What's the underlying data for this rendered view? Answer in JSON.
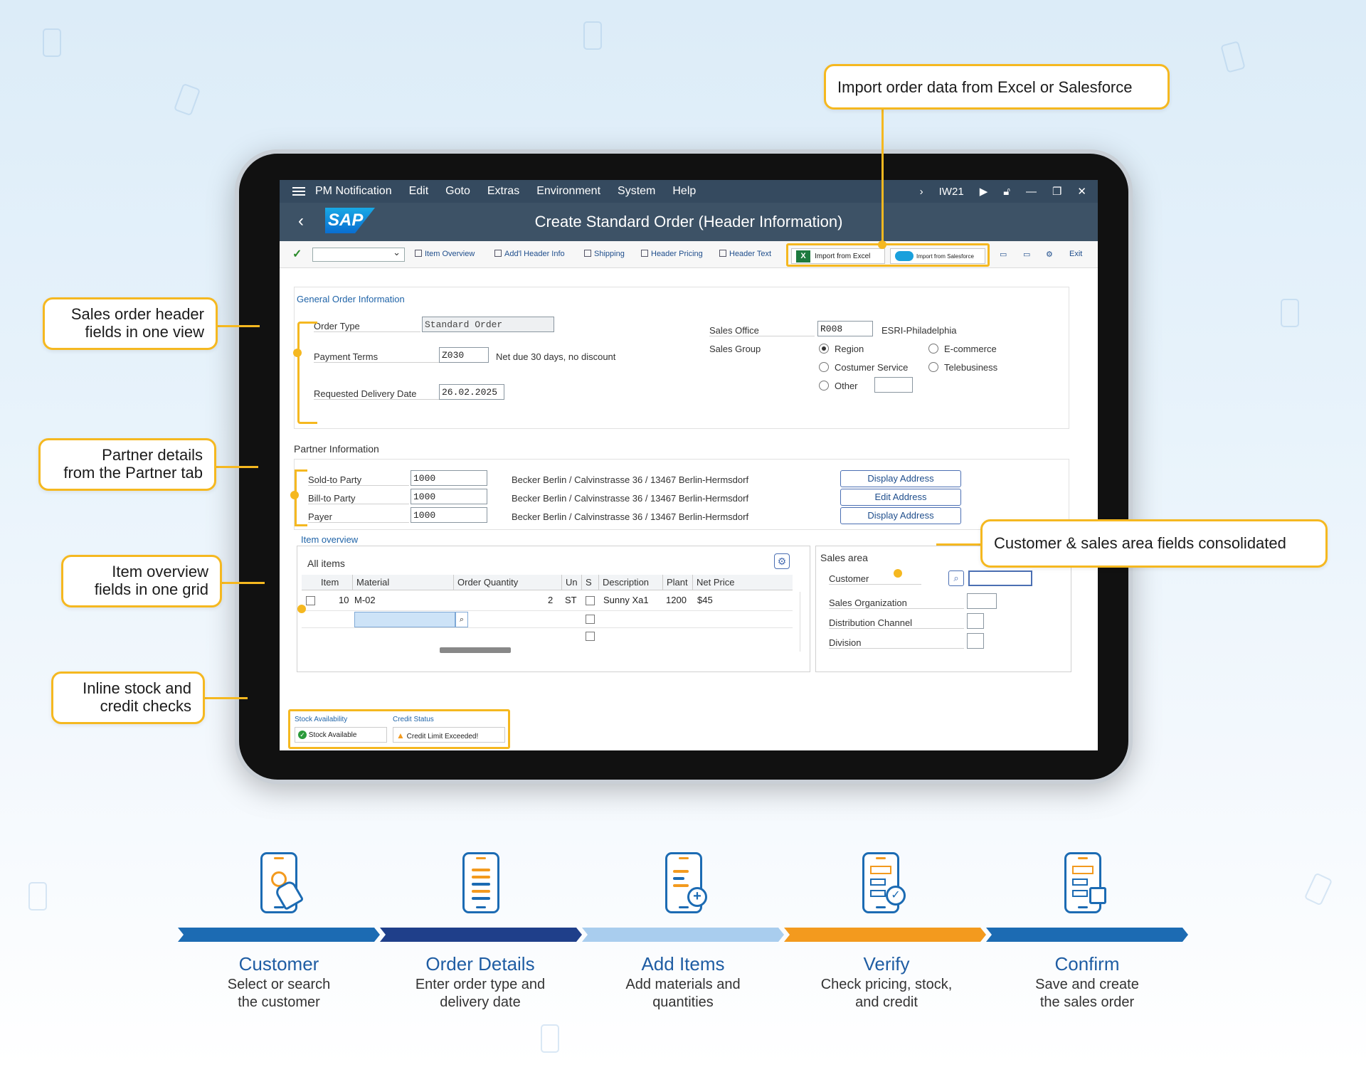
{
  "window": {
    "menu": [
      "PM Notification",
      "Edit",
      "Goto",
      "Extras",
      "Environment",
      "System",
      "Help"
    ],
    "tcode": "IW21",
    "title": "Create Standard Order (Header Information)",
    "logo": "SAP"
  },
  "toolbar": {
    "items": [
      "Item Overview",
      "Add'l Header Info",
      "Shipping",
      "Header Pricing",
      "Header Text"
    ],
    "import_excel": "Import from Excel",
    "import_salesforce": "Import from Salesforce",
    "exit": "Exit"
  },
  "general": {
    "heading": "General Order Information",
    "order_type_label": "Order Type",
    "order_type_value": "Standard Order",
    "payment_terms_label": "Payment Terms",
    "payment_terms_value": "Z030",
    "payment_terms_desc": "Net due 30 days, no discount",
    "delivery_date_label": "Requested Delivery Date",
    "delivery_date_value": "26.02.2025",
    "sales_office_label": "Sales Office",
    "sales_office_value": "R008",
    "sales_office_desc": "ESRI-Philadelphia",
    "sales_group_label": "Sales Group",
    "radios": [
      {
        "label": "Region",
        "checked": true
      },
      {
        "label": "E-commerce",
        "checked": false
      },
      {
        "label": "Costumer Service",
        "checked": false
      },
      {
        "label": "Telebusiness",
        "checked": false
      },
      {
        "label": "Other",
        "checked": false
      }
    ]
  },
  "partner": {
    "heading": "Partner Information",
    "rows": [
      {
        "label": "Sold-to Party",
        "value": "1000",
        "address": "Becker Berlin / Calvinstrasse 36 / 13467 Berlin-Hermsdorf",
        "button": "Display Address"
      },
      {
        "label": "Bill-to Party",
        "value": "1000",
        "address": "Becker Berlin / Calvinstrasse 36 / 13467 Berlin-Hermsdorf",
        "button": "Edit Address"
      },
      {
        "label": "Payer",
        "value": "1000",
        "address": "Becker Berlin / Calvinstrasse 36 / 13467 Berlin-Hermsdorf",
        "button": "Display Address"
      }
    ]
  },
  "items": {
    "tab": "Item overview",
    "title": "All items",
    "columns": [
      "Item",
      "Material",
      "Order Quantity",
      "Un",
      "S",
      "Description",
      "Plant",
      "Net Price"
    ],
    "rows": [
      {
        "item": "10",
        "material": "M-02",
        "qty": "2",
        "un": "ST",
        "desc": "Sunny Xa1",
        "plant": "1200",
        "price": "$45"
      }
    ]
  },
  "sales_area": {
    "heading": "Sales area",
    "fields": [
      "Customer",
      "Sales Organization",
      "Distribution Channel",
      "Division"
    ]
  },
  "status": {
    "stock_label": "Stock Availability",
    "stock_value": "Stock Available",
    "credit_label": "Credit Status",
    "credit_value": "Credit Limit Exceeded!"
  },
  "callouts": {
    "import": "Import order data from Excel or Salesforce",
    "header": [
      "Sales order header",
      "fields in one view"
    ],
    "partner": [
      "Partner details",
      "from the Partner tab"
    ],
    "items": [
      "Item overview",
      "fields in one grid"
    ],
    "stock": [
      "Inline stock and",
      "credit checks"
    ],
    "sales_area": "Customer & sales area fields consolidated"
  },
  "steps": [
    {
      "title": "Customer",
      "desc": [
        "Select or search",
        "the customer"
      ],
      "color": "#1c6bb3",
      "icon": "touch-phone-icon"
    },
    {
      "title": "Order Details",
      "desc": [
        "Enter order type and",
        "delivery date"
      ],
      "color": "#1f3f8a",
      "icon": "list-phone-icon"
    },
    {
      "title": "Add Items",
      "desc": [
        "Add materials and",
        "quantities"
      ],
      "color": "#a9cdee",
      "icon": "add-phone-icon"
    },
    {
      "title": "Verify",
      "desc": [
        "Check pricing, stock,",
        "and credit"
      ],
      "color": "#f39a1e",
      "icon": "check-phone-icon"
    },
    {
      "title": "Confirm",
      "desc": [
        "Save and create",
        "the sales order"
      ],
      "color": "#1c6bb3",
      "icon": "save-phone-icon"
    }
  ]
}
